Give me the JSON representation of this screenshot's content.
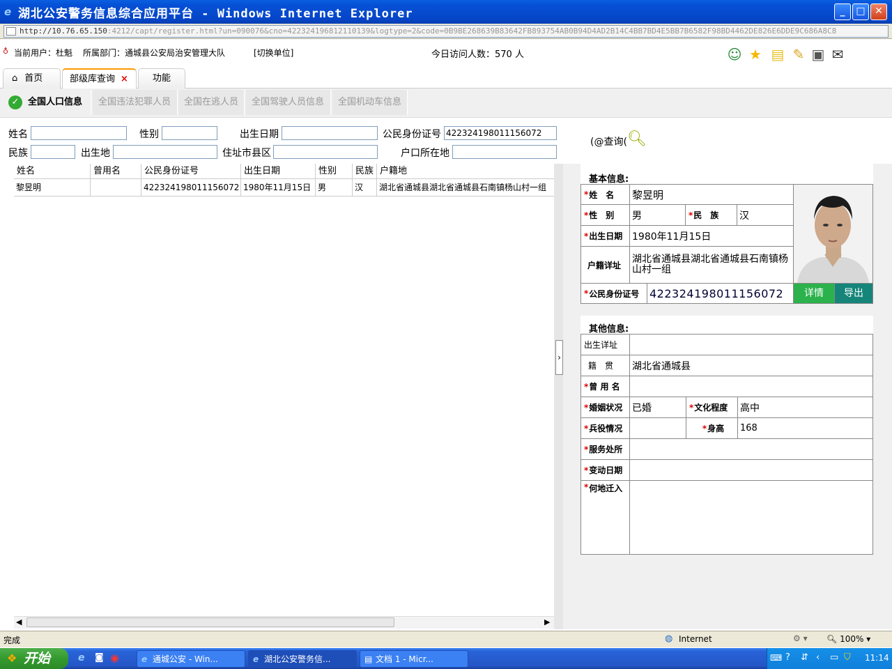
{
  "window": {
    "title": "湖北公安警务信息综合应用平台 - Windows Internet Explorer",
    "minimize": "_",
    "maximize": "□",
    "close": "✕"
  },
  "address": {
    "host": "http://10.76.65.150",
    "rest": ":4212/capt/register.html?un=090076&cno=422324196812110139&logtype=2&code=0B9BE268639B83642FB893754AB0B94D4AD2B14C4BB7BD4E5BB7B6582F98BD4462DE826E6DDE9C686A8C8"
  },
  "userbar": {
    "current_user": "当前用户：杜魁",
    "department": "所属部门：通城县公安局治安管理大队",
    "switch": "[切换单位]",
    "visits": "今日访问人数：570 人"
  },
  "tabs": [
    {
      "label": "首页"
    },
    {
      "label": "部级库查询",
      "close": "×"
    },
    {
      "label": "功能"
    }
  ],
  "subtabs": [
    "全国人口信息",
    "全国违法犯罪人员",
    "全国在逃人员",
    "全国驾驶人员信息",
    "全国机动车信息"
  ],
  "form": {
    "name": "姓名",
    "gender": "性别",
    "birthdate": "出生日期",
    "id_label": "公民身份证号",
    "id_value": "422324198011156072",
    "ethnic": "民族",
    "birthplace": "出生地",
    "county": "住址市县区",
    "household": "户口所在地",
    "query": "(@查询("
  },
  "grid": {
    "columns": [
      "姓名",
      "曾用名",
      "公民身份证号",
      "出生日期",
      "性别",
      "民族",
      "户籍地"
    ],
    "rows": [
      [
        "黎昱明",
        "",
        "422324198011156072",
        "1980年11月15日",
        "男",
        "汉",
        "湖北省通城县湖北省通城县石南镇杨山村一组"
      ]
    ]
  },
  "basic": {
    "title": "基本信息:",
    "name_label": "姓　名",
    "name": "黎昱明",
    "gender_label": "性　别",
    "gender": "男",
    "ethnic_label": "民　族",
    "ethnic": "汉",
    "birth_label": "出生日期",
    "birth": "1980年11月15日",
    "address_label": "户籍详址",
    "address": "湖北省通城县湖北省通城县石南镇杨山村一组",
    "id_label": "公民身份证号",
    "id": "422324198011156072",
    "detail_btn": "详情",
    "export_btn": "导出"
  },
  "other": {
    "title": "其他信息:",
    "birthplace_label": "出生详址",
    "birthplace": "",
    "native_label": "籍　贯",
    "native": "湖北省通城县",
    "alias_label": "曾 用 名",
    "alias": "",
    "marital_label": "婚姻状况",
    "marital": "已婚",
    "edu_label": "文化程度",
    "edu": "高中",
    "military_label": "兵役情况",
    "military": "",
    "height_label": "身高",
    "height": "168",
    "service_label": "服务处所",
    "service": "",
    "change_label": "变动日期",
    "change": "",
    "from_label": "何地迁入",
    "from": ""
  },
  "status": {
    "left": "完成",
    "zone": "Internet",
    "zoom": "100%"
  },
  "taskbar": {
    "start": "开始",
    "tasks": [
      "通城公安 - Win...",
      "湖北公安警务信...",
      "文档 1 - Micr..."
    ],
    "clock": "11:14"
  }
}
